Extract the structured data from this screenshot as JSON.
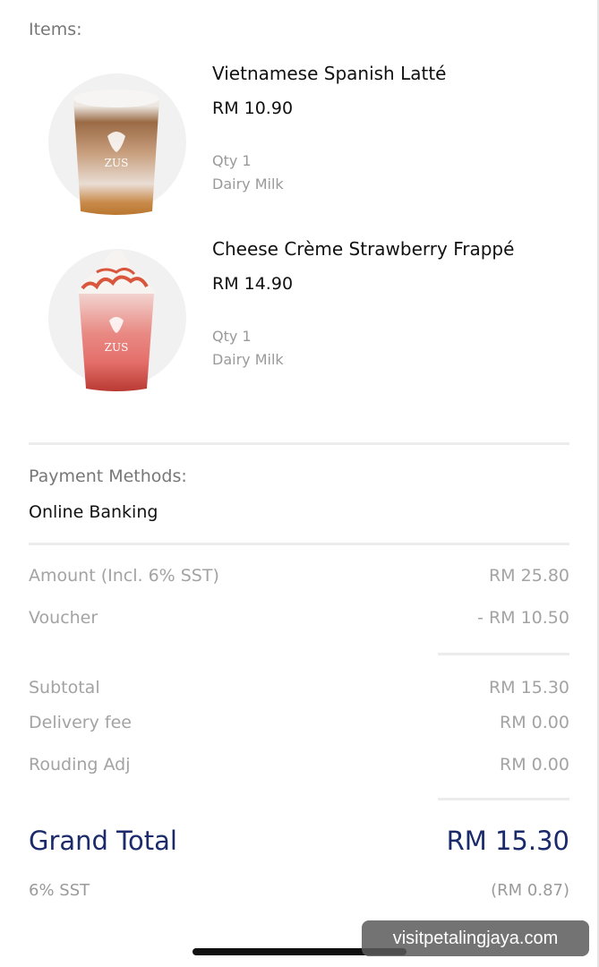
{
  "items_label": "Items:",
  "items": [
    {
      "name": "Vietnamese Spanish Latté",
      "price": "RM 10.90",
      "qty": "Qty 1",
      "option": "Dairy Milk",
      "image": "iced-latte-cup"
    },
    {
      "name": "Cheese Crème Strawberry Frappé",
      "price": "RM 14.90",
      "qty": "Qty 1",
      "option": "Dairy Milk",
      "image": "strawberry-frappe-cup"
    }
  ],
  "payment": {
    "label": "Payment Methods:",
    "value": "Online Banking"
  },
  "summary": {
    "amount": {
      "label": "Amount (Incl. 6% SST)",
      "value": "RM 25.80"
    },
    "voucher": {
      "label": "Voucher",
      "value": "- RM 10.50"
    },
    "subtotal": {
      "label": "Subtotal",
      "value": "RM 15.30"
    },
    "delivery": {
      "label": "Delivery fee",
      "value": "RM 0.00"
    },
    "rounding": {
      "label": "Rouding Adj",
      "value": "RM 0.00"
    }
  },
  "grand_total": {
    "label": "Grand Total",
    "value": "RM 15.30"
  },
  "sst": {
    "label": "6% SST",
    "value": "(RM 0.87)"
  },
  "watermark": "visitpetalingjaya.com",
  "colors": {
    "accent": "#1b2a6b",
    "muted": "#a3a3a3",
    "divider": "#ececec"
  }
}
